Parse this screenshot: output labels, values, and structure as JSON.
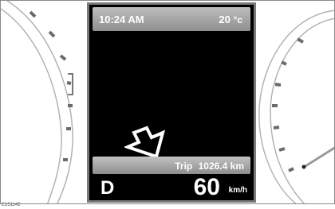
{
  "status_bar": {
    "time": "10:24 AM",
    "temperature_value": "20",
    "temperature_unit": "°c"
  },
  "navigation": {
    "arrow_icon": "turn-arrow-icon"
  },
  "trip": {
    "label": "Trip",
    "value": "1026.4 km"
  },
  "drive": {
    "gear": "D",
    "speed": "60",
    "speed_unit": "km/h"
  },
  "figure_code": "E151142"
}
